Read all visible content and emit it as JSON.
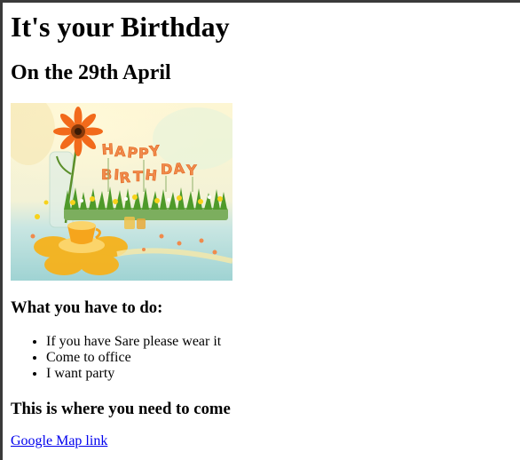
{
  "page": {
    "title": "It's your Birthday",
    "date_heading": "On the 29th April"
  },
  "image": {
    "lettering": "HAPPY BIRTHDAY",
    "colors": {
      "background_top": "#fbf3c9",
      "table": "#a9d9d8",
      "flower": "#f26a1b",
      "grass": "#4e9a2a",
      "cup": "#f6a51c"
    }
  },
  "todo": {
    "heading": "What you have to do:",
    "items": [
      "If you have Sare please wear it",
      "Come to office",
      "I want party"
    ]
  },
  "location": {
    "heading": "This is where you need to come",
    "link_text": "Google Map link"
  }
}
